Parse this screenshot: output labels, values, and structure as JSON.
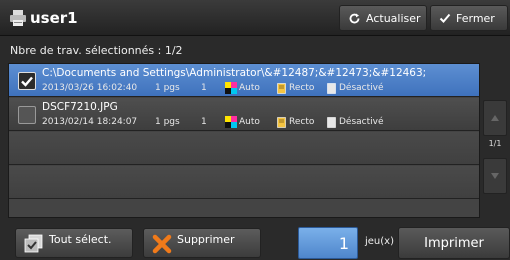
{
  "header": {
    "title": "user1",
    "refresh_label": "Actualiser",
    "close_label": "Fermer"
  },
  "selection_count": "Nbre de trav. sélectionnés : 1/2",
  "jobs": [
    {
      "name": "C:\\Documents and Settings\\Administrator\\&#12487;&#12473;&#12463;",
      "date": "2013/03/26 16:02:40",
      "pages": "1 pgs",
      "copies": "1",
      "color": "Auto",
      "side": "Recto",
      "staple": "Désactivé",
      "selected": true
    },
    {
      "name": "DSCF7210.JPG",
      "date": "2013/02/14 18:24:07",
      "pages": "1 pgs",
      "copies": "1",
      "color": "Auto",
      "side": "Recto",
      "staple": "Désactivé",
      "selected": false
    }
  ],
  "pager": {
    "indicator": "1/1"
  },
  "footer": {
    "select_all_label": "Tout sélect.",
    "delete_label": "Supprimer",
    "copies_value": "1",
    "copies_unit": "jeu(x)",
    "print_label": "Imprimer"
  },
  "colors": {
    "selected_row": "#4f82c8",
    "copies_box": "#5f96d8",
    "delete_icon": "#f07a1a"
  }
}
